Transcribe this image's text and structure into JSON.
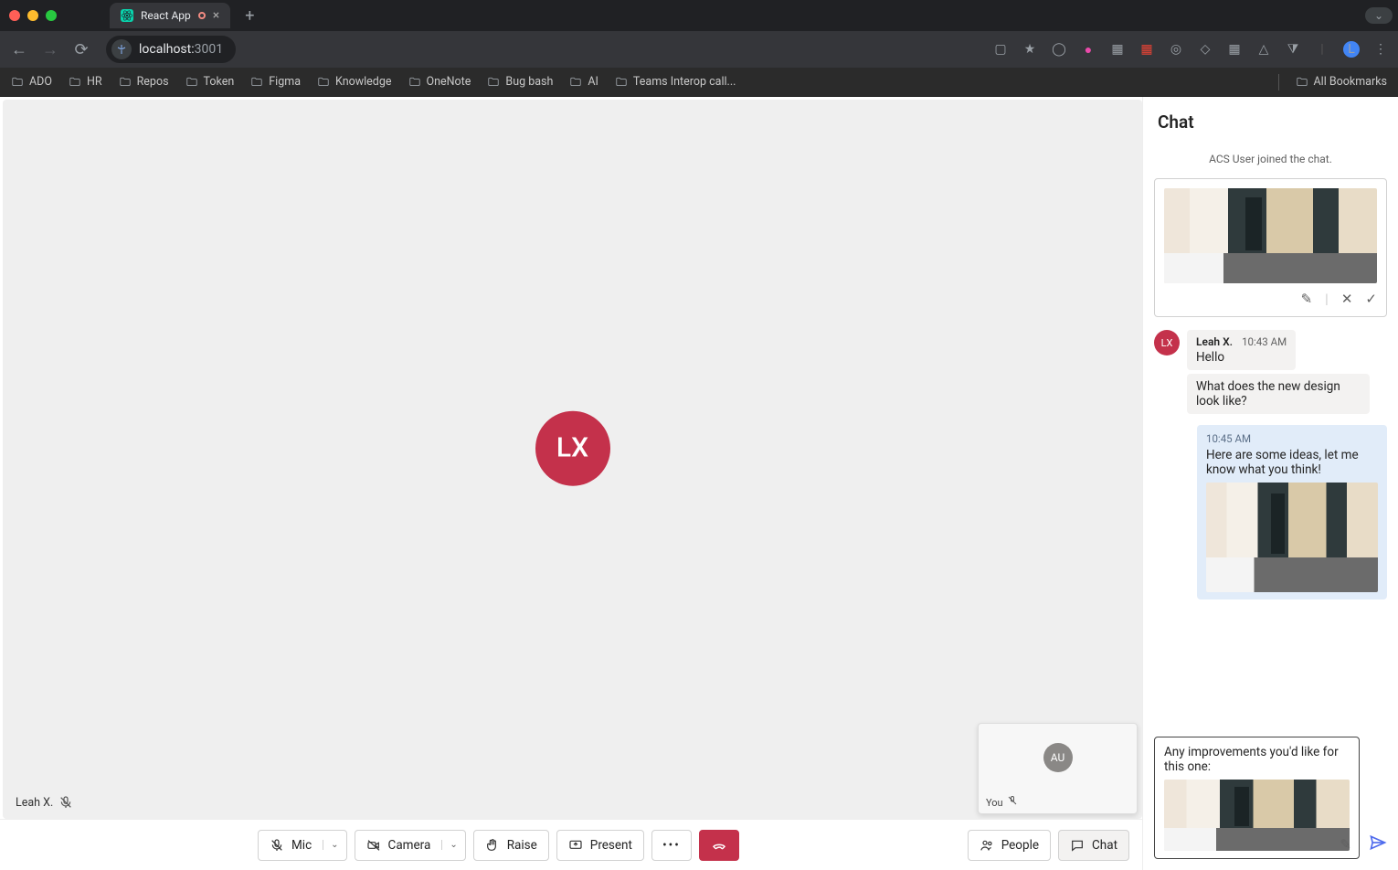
{
  "browser": {
    "tab_title": "React App",
    "url_host": "localhost:",
    "url_port": "3001",
    "bookmarks": [
      "ADO",
      "HR",
      "Repos",
      "Token",
      "Figma",
      "Knowledge",
      "OneNote",
      "Bug bash",
      "AI",
      "Teams Interop call..."
    ],
    "all_bookmarks": "All Bookmarks",
    "profile_initial": "L"
  },
  "call": {
    "main_avatar": "LX",
    "participant_name": "Leah X.",
    "pip_avatar": "AU",
    "pip_label": "You"
  },
  "chat": {
    "title": "Chat",
    "system": "ACS User joined the chat.",
    "msg1": {
      "who": "Leah X.",
      "time": "10:43 AM",
      "text": "Hello"
    },
    "msg2": {
      "text": "What does the new design look like?"
    },
    "me1": {
      "time": "10:45 AM",
      "text": "Here are some ideas, let me know what you think!"
    },
    "composer_text": "Any improvements you'd like for this one:"
  },
  "footer": {
    "mic": "Mic",
    "camera": "Camera",
    "raise": "Raise",
    "present": "Present",
    "people": "People",
    "chat": "Chat"
  }
}
